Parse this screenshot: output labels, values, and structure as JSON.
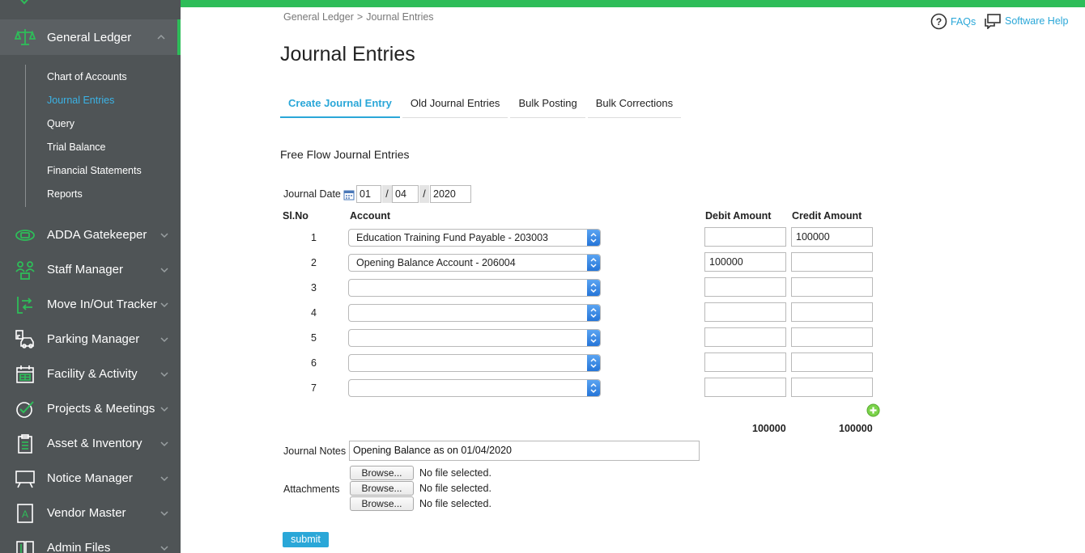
{
  "sidebar": {
    "active_group": "General Ledger",
    "submenu": [
      "Chart of Accounts",
      "Journal Entries",
      "Query",
      "Trial Balance",
      "Financial Statements",
      "Reports"
    ],
    "active_submenu": "Journal Entries",
    "items": [
      "ADDA Gatekeeper",
      "Staff Manager",
      "Move In/Out Tracker",
      "Parking Manager",
      "Facility & Activity",
      "Projects & Meetings",
      "Asset & Inventory",
      "Notice Manager",
      "Vendor Master",
      "Admin Files"
    ]
  },
  "breadcrumb": {
    "root": "General Ledger",
    "sep": ">",
    "current": "Journal Entries"
  },
  "help": {
    "faqs": "FAQs",
    "software_help": "Software Help"
  },
  "page_title": "Journal Entries",
  "tabs": [
    "Create Journal Entry",
    "Old Journal Entries",
    "Bulk Posting",
    "Bulk Corrections"
  ],
  "active_tab": "Create Journal Entry",
  "section_title": "Free Flow Journal Entries",
  "form": {
    "journal_date_label": "Journal Date",
    "date": {
      "day": "01",
      "month": "04",
      "year": "2020",
      "sep": "/"
    },
    "headers": {
      "slno": "Sl.No",
      "account": "Account",
      "debit": "Debit Amount",
      "credit": "Credit Amount"
    },
    "rows": [
      {
        "no": "1",
        "account": "Education Training Fund Payable - 203003",
        "debit": "",
        "credit": "100000"
      },
      {
        "no": "2",
        "account": "Opening Balance Account - 206004",
        "debit": "100000",
        "credit": ""
      },
      {
        "no": "3",
        "account": "",
        "debit": "",
        "credit": ""
      },
      {
        "no": "4",
        "account": "",
        "debit": "",
        "credit": ""
      },
      {
        "no": "5",
        "account": "",
        "debit": "",
        "credit": ""
      },
      {
        "no": "6",
        "account": "",
        "debit": "",
        "credit": ""
      },
      {
        "no": "7",
        "account": "",
        "debit": "",
        "credit": ""
      }
    ],
    "total_debit": "100000",
    "total_credit": "100000",
    "notes_label": "Journal Notes",
    "notes_value": "Opening Balance as on 01/04/2020",
    "attachments_label": "Attachments",
    "attachments": [
      {
        "button": "Browse...",
        "status": "No file selected."
      },
      {
        "button": "Browse...",
        "status": "No file selected."
      },
      {
        "button": "Browse...",
        "status": "No file selected."
      }
    ],
    "submit_label": "submit"
  },
  "colors": {
    "accent_green": "#2ebd59",
    "link_blue": "#2aa7d8",
    "sidebar_bg": "#4f5456"
  }
}
